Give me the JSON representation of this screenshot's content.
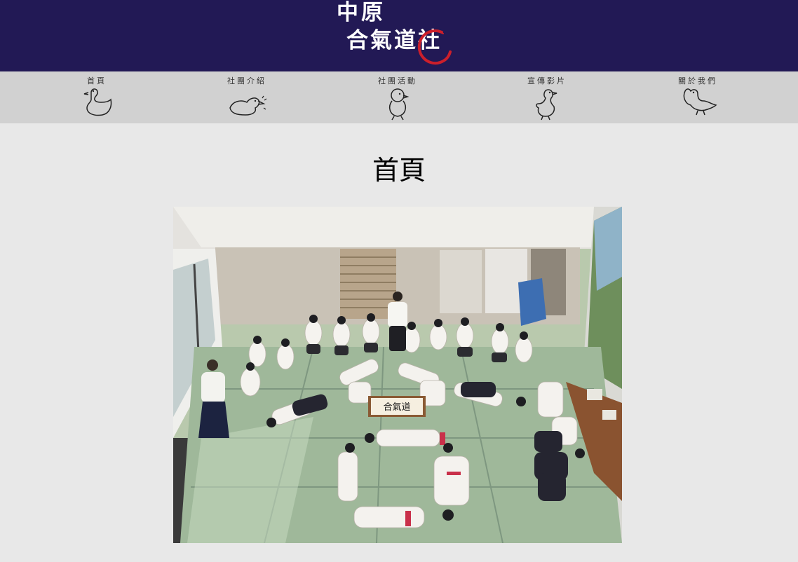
{
  "header": {
    "logo_line1": "中原",
    "logo_line2": "合氣道社",
    "background_color": "#221955",
    "accent_color": "#cc1f2b"
  },
  "nav": {
    "items": [
      {
        "label": "首頁",
        "icon": "duck-sitting-icon"
      },
      {
        "label": "社團介紹",
        "icon": "duck-lying-icon"
      },
      {
        "label": "社團活動",
        "icon": "duckling-icon"
      },
      {
        "label": "宣傳影片",
        "icon": "duck-standing-icon"
      },
      {
        "label": "關於我們",
        "icon": "duck-flapping-icon"
      }
    ]
  },
  "main": {
    "title": "首頁",
    "photo_sign_text": "合氣道"
  }
}
